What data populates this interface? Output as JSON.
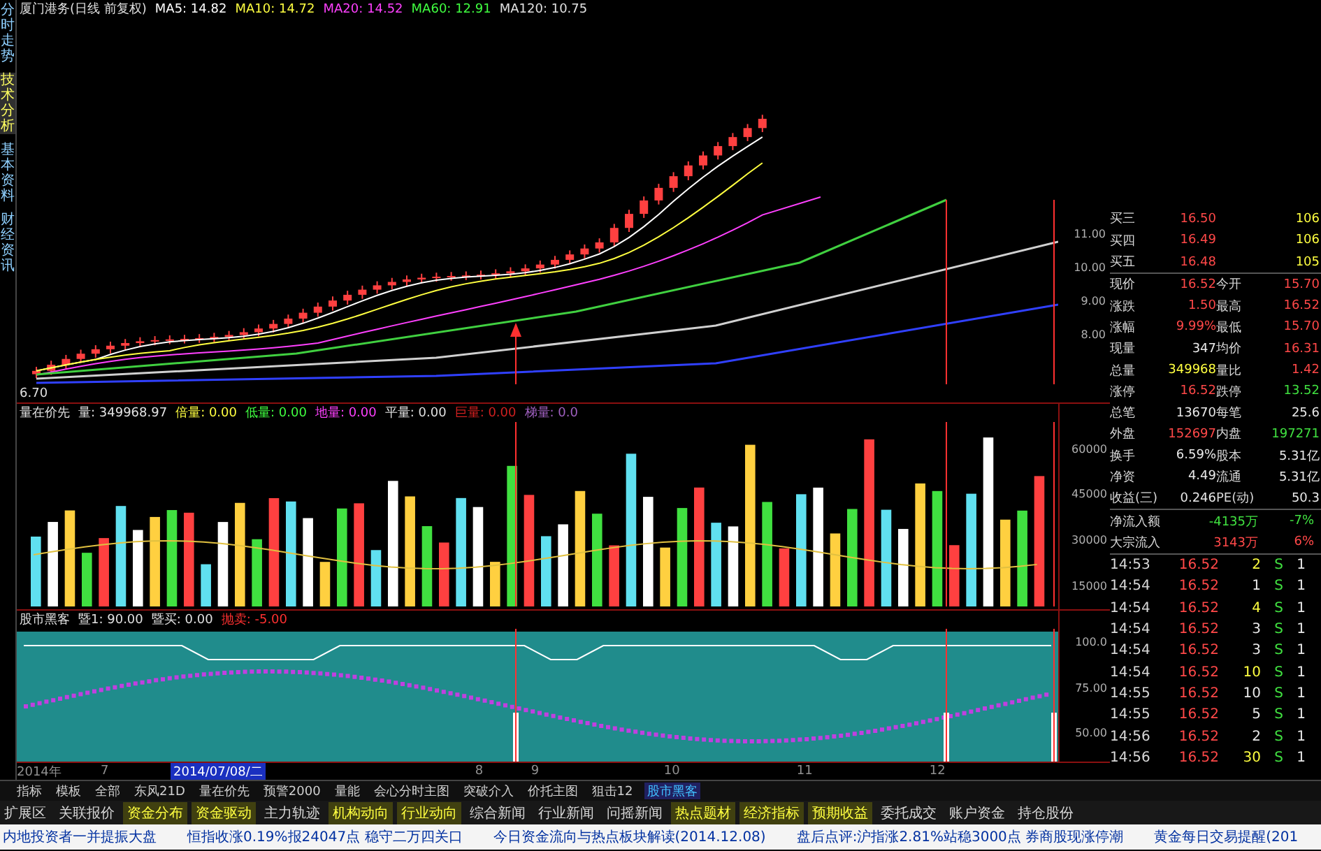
{
  "side_tabs": [
    {
      "label": "分时走势",
      "selected": false
    },
    {
      "label": "技术分析",
      "selected": true
    },
    {
      "label": "基本资料",
      "selected": false
    },
    {
      "label": "财经资讯",
      "selected": false
    }
  ],
  "price_panel": {
    "title": "厦门港务(日线 前复权)",
    "low_label": "6.70",
    "ma": [
      {
        "label": "MA5: 14.82",
        "color": "#ffffff"
      },
      {
        "label": "MA10: 14.72",
        "color": "#ffff40"
      },
      {
        "label": "MA20: 14.52",
        "color": "#ff40ff"
      },
      {
        "label": "MA60: 12.91",
        "color": "#40ff40"
      },
      {
        "label": "MA120: 10.75",
        "color": "#e0e0e0"
      }
    ],
    "yaxis": [
      "11.00",
      "10.00",
      "9.00",
      "8.00"
    ]
  },
  "volume_panel": {
    "header": [
      {
        "label": "量在价先",
        "color": "#e0e0e0"
      },
      {
        "label": "量: 349968.97",
        "color": "#e0e0e0"
      },
      {
        "label": "倍量: 0.00",
        "color": "#ffff40"
      },
      {
        "label": "低量: 0.00",
        "color": "#40ff40"
      },
      {
        "label": "地量: 0.00",
        "color": "#ff40ff"
      },
      {
        "label": "平量: 0.00",
        "color": "#e0e0e0"
      },
      {
        "label": "巨量: 0.00",
        "color": "#d02020"
      },
      {
        "label": "梯量: 0.0",
        "color": "#a060c0"
      }
    ],
    "yaxis": [
      "60000",
      "45000",
      "30000",
      "15000"
    ]
  },
  "indicator_panel": {
    "header": [
      {
        "label": "股市黑客",
        "color": "#e0e0e0"
      },
      {
        "label": "暨1: 90.00",
        "color": "#e0e0e0"
      },
      {
        "label": "暨买: 0.00",
        "color": "#e0e0e0"
      },
      {
        "label": "抛卖: -5.00",
        "color": "#ff3030"
      }
    ],
    "yaxis": [
      "100.0",
      "75.00",
      "50.00"
    ]
  },
  "date_axis": {
    "labels": [
      "2014年",
      "7",
      "8",
      "9",
      "10",
      "11",
      "12"
    ],
    "cursor": "2014/07/08/二"
  },
  "quotes": [
    {
      "label": "买三",
      "price": "16.50",
      "volume": "106"
    },
    {
      "label": "买四",
      "price": "16.49",
      "volume": "106"
    },
    {
      "label": "买五",
      "price": "16.48",
      "volume": "105"
    }
  ],
  "stats": [
    {
      "left": {
        "label": "现价",
        "value": "16.52",
        "color": "#ff4848"
      },
      "right": {
        "label": "今开",
        "value": "15.70",
        "color": "#ff4848"
      }
    },
    {
      "left": {
        "label": "涨跌",
        "value": "1.50",
        "color": "#ff4848"
      },
      "right": {
        "label": "最高",
        "value": "16.52",
        "color": "#ff4848"
      }
    },
    {
      "left": {
        "label": "涨幅",
        "value": "9.99%",
        "color": "#ff4848"
      },
      "right": {
        "label": "最低",
        "value": "15.70",
        "color": "#ff4848"
      }
    },
    {
      "left": {
        "label": "现量",
        "value": "347",
        "color": "#e8e8e8"
      },
      "right": {
        "label": "均价",
        "value": "16.31",
        "color": "#ff4848"
      }
    },
    {
      "left": {
        "label": "总量",
        "value": "349968",
        "color": "#ffff40"
      },
      "right": {
        "label": "量比",
        "value": "1.42",
        "color": "#ff4848"
      }
    },
    {
      "left": {
        "label": "涨停",
        "value": "16.52",
        "color": "#ff4848"
      },
      "right": {
        "label": "跌停",
        "value": "13.52",
        "color": "#40e040"
      }
    },
    {
      "left": {
        "label": "总笔",
        "value": "13670",
        "color": "#e8e8e8"
      },
      "right": {
        "label": "每笔",
        "value": "25.6",
        "color": "#e8e8e8"
      }
    },
    {
      "left": {
        "label": "外盘",
        "value": "152697",
        "color": "#ff4848"
      },
      "right": {
        "label": "内盘",
        "value": "197271",
        "color": "#40e040"
      }
    },
    {
      "left": {
        "label": "换手",
        "value": "6.59%",
        "color": "#e8e8e8"
      },
      "right": {
        "label": "股本",
        "value": "5.31亿",
        "color": "#e8e8e8"
      }
    },
    {
      "left": {
        "label": "净资",
        "value": "4.49",
        "color": "#e8e8e8"
      },
      "right": {
        "label": "流通",
        "value": "5.31亿",
        "color": "#e8e8e8"
      }
    },
    {
      "left": {
        "label": "收益(三)",
        "value": "0.246",
        "color": "#e8e8e8"
      },
      "right": {
        "label": "PE(动)",
        "value": "50.3",
        "color": "#e8e8e8"
      }
    }
  ],
  "flows": [
    {
      "label": "净流入额",
      "value": "-4135万",
      "pct": "-7%",
      "color": "#40e040"
    },
    {
      "label": "大宗流入",
      "value": "3143万",
      "pct": "6%",
      "color": "#ff4848"
    }
  ],
  "ticks": [
    {
      "time": "14:53",
      "price": "16.52",
      "volume": "2",
      "color": "#ffff40",
      "side": "S",
      "count": "1"
    },
    {
      "time": "14:54",
      "price": "16.52",
      "volume": "1",
      "color": "#e8e8e8",
      "side": "S",
      "count": "1"
    },
    {
      "time": "14:54",
      "price": "16.52",
      "volume": "4",
      "color": "#ffff40",
      "side": "S",
      "count": "1"
    },
    {
      "time": "14:54",
      "price": "16.52",
      "volume": "3",
      "color": "#e8e8e8",
      "side": "S",
      "count": "1"
    },
    {
      "time": "14:54",
      "price": "16.52",
      "volume": "3",
      "color": "#e8e8e8",
      "side": "S",
      "count": "1"
    },
    {
      "time": "14:54",
      "price": "16.52",
      "volume": "10",
      "color": "#ffff40",
      "side": "S",
      "count": "1"
    },
    {
      "time": "14:55",
      "price": "16.52",
      "volume": "10",
      "color": "#e8e8e8",
      "side": "S",
      "count": "1"
    },
    {
      "time": "14:55",
      "price": "16.52",
      "volume": "5",
      "color": "#e8e8e8",
      "side": "S",
      "count": "1"
    },
    {
      "time": "14:56",
      "price": "16.52",
      "volume": "2",
      "color": "#e8e8e8",
      "side": "S",
      "count": "1"
    },
    {
      "time": "14:56",
      "price": "16.52",
      "volume": "30",
      "color": "#ffff40",
      "side": "S",
      "count": "1"
    }
  ],
  "indicator_tabs": [
    {
      "label": "指标",
      "selected": false
    },
    {
      "label": "模板",
      "selected": false
    },
    {
      "label": "全部",
      "selected": false
    },
    {
      "label": "东风21D",
      "selected": false
    },
    {
      "label": "量在价先",
      "selected": false
    },
    {
      "label": "预警2000",
      "selected": false
    },
    {
      "label": "量能",
      "selected": false
    },
    {
      "label": "会心分时主图",
      "selected": false
    },
    {
      "label": "突破介入",
      "selected": false
    },
    {
      "label": "价托主图",
      "selected": false
    },
    {
      "label": "狙击12",
      "selected": false
    },
    {
      "label": "股市黑客",
      "selected": true
    }
  ],
  "extension_tabs": [
    {
      "label": "扩展区",
      "highlighted": false
    },
    {
      "label": "关联报价",
      "highlighted": false
    },
    {
      "label": "资金分布",
      "highlighted": true
    },
    {
      "label": "资金驱动",
      "highlighted": true
    },
    {
      "label": "主力轨迹",
      "highlighted": false
    },
    {
      "label": "机构动向",
      "highlighted": true
    },
    {
      "label": "行业动向",
      "highlighted": true
    },
    {
      "label": "综合新闻",
      "highlighted": false
    },
    {
      "label": "行业新闻",
      "highlighted": false
    },
    {
      "label": "问摇新闻",
      "highlighted": false
    },
    {
      "label": "热点题材",
      "highlighted": true
    },
    {
      "label": "经济指标",
      "highlighted": true
    },
    {
      "label": "预期收益",
      "highlighted": true
    },
    {
      "label": "委托成交",
      "highlighted": false
    },
    {
      "label": "账户资金",
      "highlighted": false
    },
    {
      "label": "持仓股份",
      "highlighted": false
    }
  ],
  "news_ticker": [
    "内地投资者一并提振大盘",
    "恒指收涨0.19%报24047点 稳守二万四关口",
    "今日资金流向与热点板块解读(2014.12.08)",
    "盘后点评:沪指涨2.81%站稳3000点 券商股现涨停潮",
    "黄金每日交易提醒(201"
  ]
}
